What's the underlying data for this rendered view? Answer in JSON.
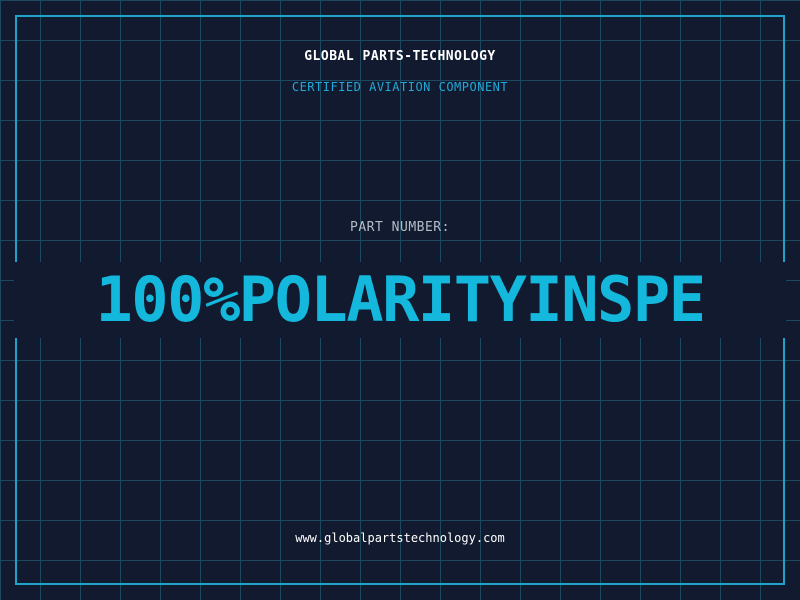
{
  "header": {
    "company": "GLOBAL PARTS-TECHNOLOGY",
    "tagline": "CERTIFIED AVIATION COMPONENT"
  },
  "part": {
    "label": "PART NUMBER:",
    "value": "100%POLARITYINSPE"
  },
  "footer": {
    "url": "www.globalpartstechnology.com"
  },
  "colors": {
    "background": "#121a2f",
    "grid": "#1d4a61",
    "frame": "#1fa3c9",
    "accent": "#13b8dc",
    "tagline": "#22a8d8"
  }
}
